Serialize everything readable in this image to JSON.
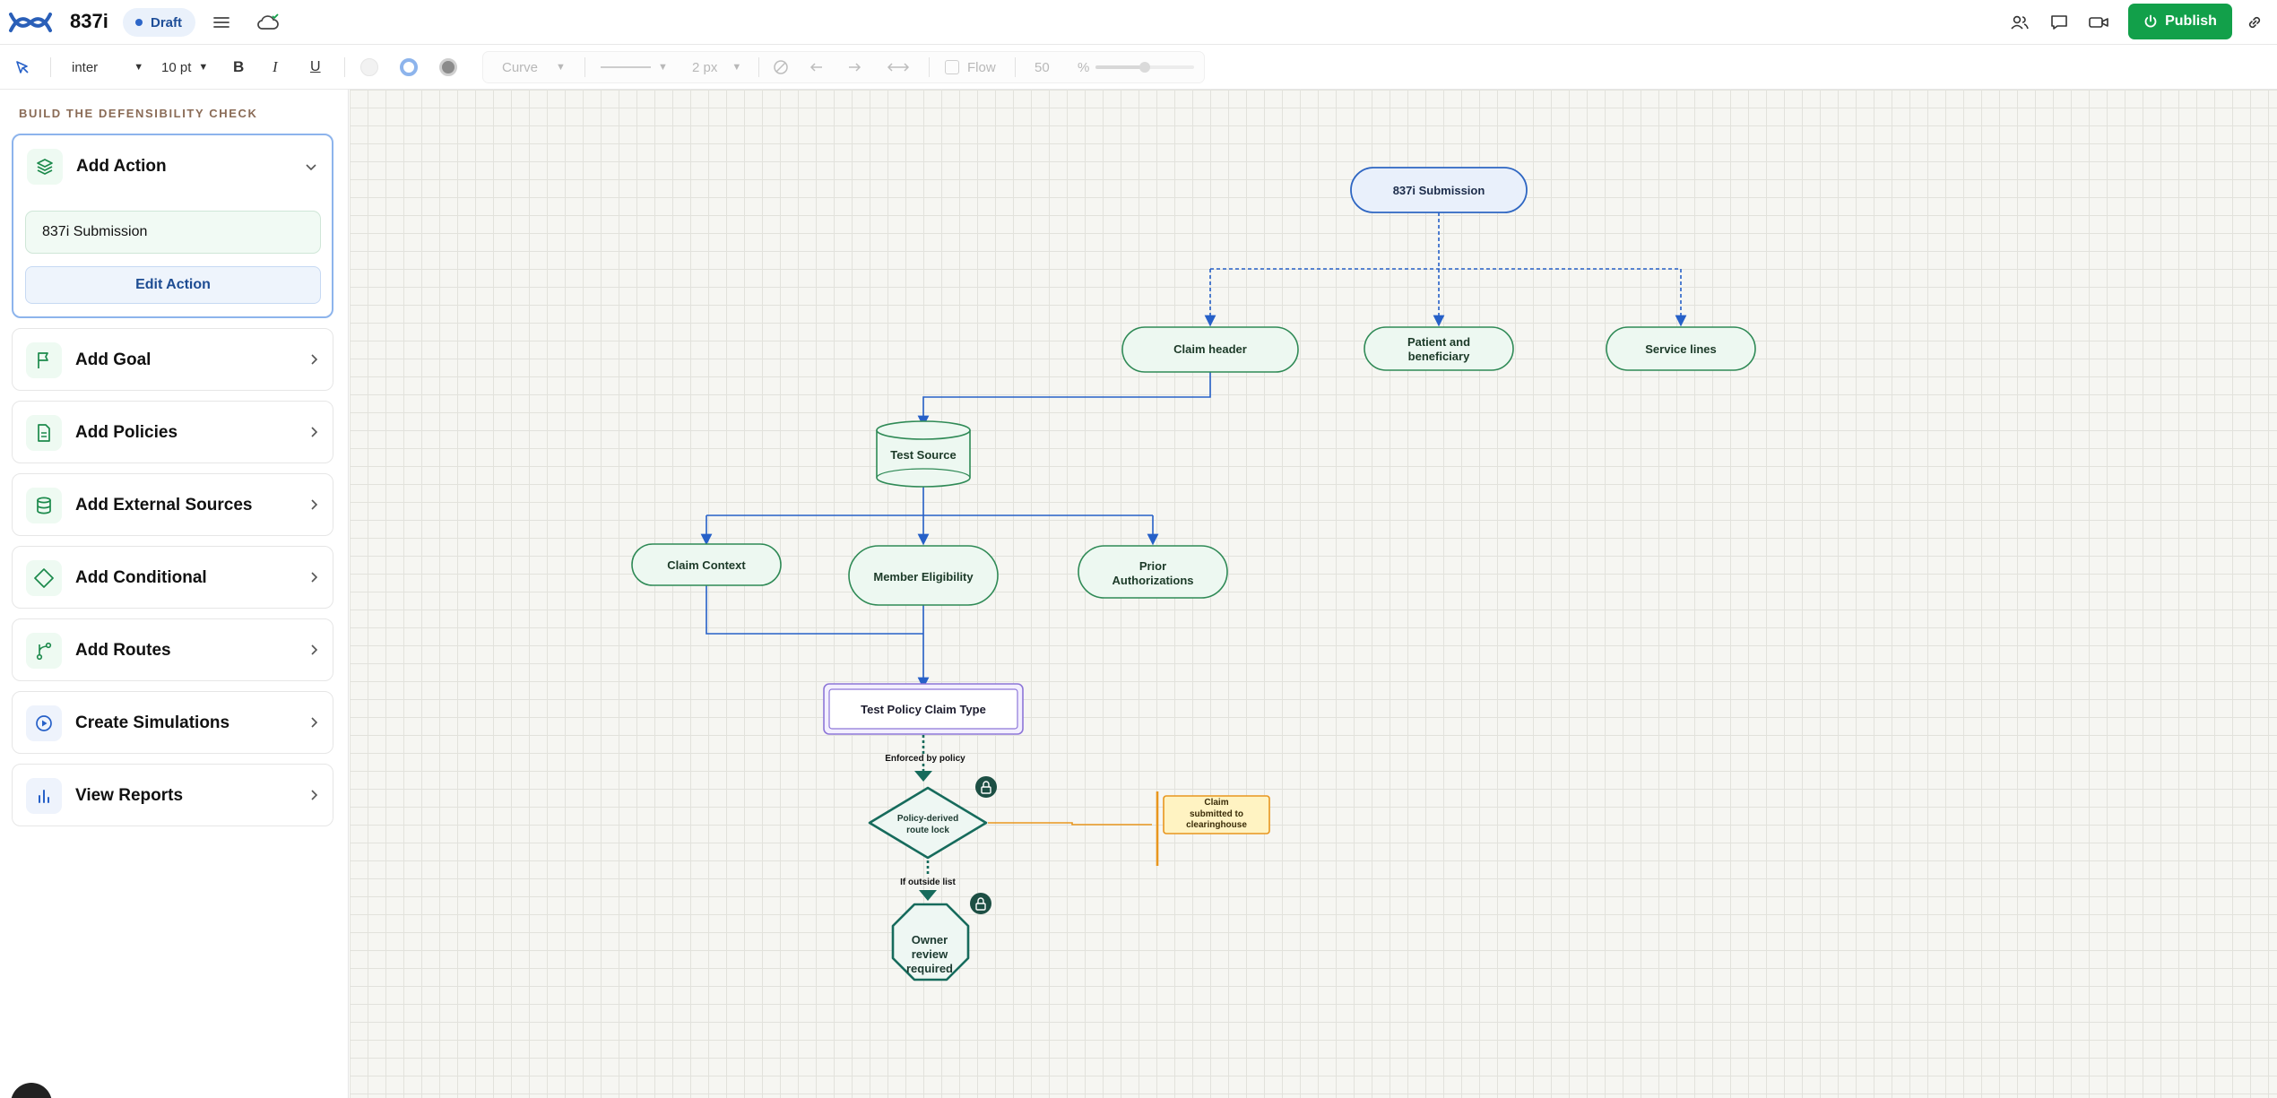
{
  "header": {
    "title": "837i",
    "status": "Draft",
    "publish_label": "Publish"
  },
  "toolbar": {
    "font": "inter",
    "size": "10 pt",
    "bold": "B",
    "italic": "I",
    "underline": "U",
    "line_type": "Curve",
    "stroke_width": "2 px",
    "flow_label": "Flow",
    "opacity_value": "50",
    "opacity_unit": "%"
  },
  "sidebar": {
    "title": "BUILD THE DEFENSIBILITY CHECK",
    "action": {
      "label": "Add Action",
      "value": "837i Submission",
      "edit_label": "Edit Action"
    },
    "items": [
      {
        "label": "Add Goal",
        "icon": "flag-icon"
      },
      {
        "label": "Add Policies",
        "icon": "document-icon"
      },
      {
        "label": "Add External Sources",
        "icon": "database-icon"
      },
      {
        "label": "Add Conditional",
        "icon": "diamond-icon"
      },
      {
        "label": "Add Routes",
        "icon": "route-icon"
      },
      {
        "label": "Create Simulations",
        "icon": "play-icon"
      },
      {
        "label": "View Reports",
        "icon": "bar-chart-icon"
      }
    ]
  },
  "diagram": {
    "root": "837i Submission",
    "claim_header": "Claim header",
    "patient_line1": "Patient and",
    "patient_line2": "beneficiary",
    "service_lines": "Service lines",
    "test_source": "Test Source",
    "claim_context": "Claim Context",
    "member_eligibility": "Member Eligibility",
    "prior_line1": "Prior",
    "prior_line2": "Authorizations",
    "policy": "Test Policy Claim Type",
    "enforced_label": "Enforced by policy",
    "decision_line1": "Policy-derived",
    "decision_line2": "route lock",
    "outside_label": "If outside list",
    "submitted_line1": "Claim",
    "submitted_line2": "submitted to",
    "submitted_line3": "clearinghouse",
    "review_line1": "Owner",
    "review_line2": "review",
    "review_line3": "required"
  },
  "colors": {
    "accent_green": "#12a04a",
    "node_green": "#2f8a56",
    "connector_blue": "#2660c8",
    "policy_purple": "#8d76d8",
    "decision_teal": "#166b5c",
    "note_orange": "#e8961e"
  }
}
